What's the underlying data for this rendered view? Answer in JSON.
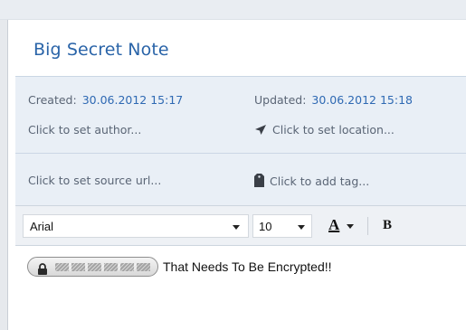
{
  "note": {
    "title": "Big Secret Note",
    "created_label": "Created:",
    "created_value": "30.06.2012 15:17",
    "updated_label": "Updated:",
    "updated_value": "30.06.2012 15:18",
    "author_placeholder": "Click to set author...",
    "location_placeholder": "Click to set location...",
    "source_url_placeholder": "Click to set source url...",
    "tag_placeholder": "Click to add tag..."
  },
  "toolbar": {
    "font_family": "Arial",
    "font_size": "10",
    "text_color_label": "A",
    "bold_label": "B"
  },
  "editor": {
    "encrypted_block_icon": "lock-icon",
    "body_text": "That Needs To Be Encrypted!!"
  },
  "icons": {
    "location": "arrow-pointer-icon",
    "tag": "tag-icon"
  },
  "colors": {
    "title": "#2a64a8",
    "value_link": "#2e69b3",
    "meta_background": "#e9eff6",
    "label_gray": "#5a6575"
  }
}
